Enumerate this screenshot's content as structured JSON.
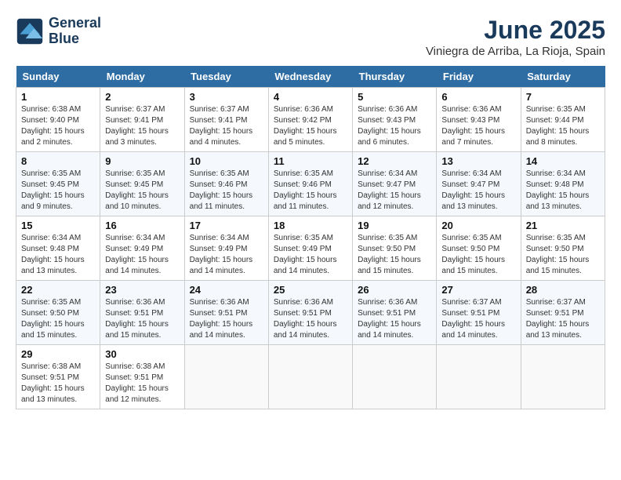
{
  "logo": {
    "line1": "General",
    "line2": "Blue"
  },
  "title": "June 2025",
  "subtitle": "Viniegra de Arriba, La Rioja, Spain",
  "weekdays": [
    "Sunday",
    "Monday",
    "Tuesday",
    "Wednesday",
    "Thursday",
    "Friday",
    "Saturday"
  ],
  "weeks": [
    [
      {
        "day": "1",
        "sunrise": "Sunrise: 6:38 AM",
        "sunset": "Sunset: 9:40 PM",
        "daylight": "Daylight: 15 hours and 2 minutes."
      },
      {
        "day": "2",
        "sunrise": "Sunrise: 6:37 AM",
        "sunset": "Sunset: 9:41 PM",
        "daylight": "Daylight: 15 hours and 3 minutes."
      },
      {
        "day": "3",
        "sunrise": "Sunrise: 6:37 AM",
        "sunset": "Sunset: 9:41 PM",
        "daylight": "Daylight: 15 hours and 4 minutes."
      },
      {
        "day": "4",
        "sunrise": "Sunrise: 6:36 AM",
        "sunset": "Sunset: 9:42 PM",
        "daylight": "Daylight: 15 hours and 5 minutes."
      },
      {
        "day": "5",
        "sunrise": "Sunrise: 6:36 AM",
        "sunset": "Sunset: 9:43 PM",
        "daylight": "Daylight: 15 hours and 6 minutes."
      },
      {
        "day": "6",
        "sunrise": "Sunrise: 6:36 AM",
        "sunset": "Sunset: 9:43 PM",
        "daylight": "Daylight: 15 hours and 7 minutes."
      },
      {
        "day": "7",
        "sunrise": "Sunrise: 6:35 AM",
        "sunset": "Sunset: 9:44 PM",
        "daylight": "Daylight: 15 hours and 8 minutes."
      }
    ],
    [
      {
        "day": "8",
        "sunrise": "Sunrise: 6:35 AM",
        "sunset": "Sunset: 9:45 PM",
        "daylight": "Daylight: 15 hours and 9 minutes."
      },
      {
        "day": "9",
        "sunrise": "Sunrise: 6:35 AM",
        "sunset": "Sunset: 9:45 PM",
        "daylight": "Daylight: 15 hours and 10 minutes."
      },
      {
        "day": "10",
        "sunrise": "Sunrise: 6:35 AM",
        "sunset": "Sunset: 9:46 PM",
        "daylight": "Daylight: 15 hours and 11 minutes."
      },
      {
        "day": "11",
        "sunrise": "Sunrise: 6:35 AM",
        "sunset": "Sunset: 9:46 PM",
        "daylight": "Daylight: 15 hours and 11 minutes."
      },
      {
        "day": "12",
        "sunrise": "Sunrise: 6:34 AM",
        "sunset": "Sunset: 9:47 PM",
        "daylight": "Daylight: 15 hours and 12 minutes."
      },
      {
        "day": "13",
        "sunrise": "Sunrise: 6:34 AM",
        "sunset": "Sunset: 9:47 PM",
        "daylight": "Daylight: 15 hours and 13 minutes."
      },
      {
        "day": "14",
        "sunrise": "Sunrise: 6:34 AM",
        "sunset": "Sunset: 9:48 PM",
        "daylight": "Daylight: 15 hours and 13 minutes."
      }
    ],
    [
      {
        "day": "15",
        "sunrise": "Sunrise: 6:34 AM",
        "sunset": "Sunset: 9:48 PM",
        "daylight": "Daylight: 15 hours and 13 minutes."
      },
      {
        "day": "16",
        "sunrise": "Sunrise: 6:34 AM",
        "sunset": "Sunset: 9:49 PM",
        "daylight": "Daylight: 15 hours and 14 minutes."
      },
      {
        "day": "17",
        "sunrise": "Sunrise: 6:34 AM",
        "sunset": "Sunset: 9:49 PM",
        "daylight": "Daylight: 15 hours and 14 minutes."
      },
      {
        "day": "18",
        "sunrise": "Sunrise: 6:35 AM",
        "sunset": "Sunset: 9:49 PM",
        "daylight": "Daylight: 15 hours and 14 minutes."
      },
      {
        "day": "19",
        "sunrise": "Sunrise: 6:35 AM",
        "sunset": "Sunset: 9:50 PM",
        "daylight": "Daylight: 15 hours and 15 minutes."
      },
      {
        "day": "20",
        "sunrise": "Sunrise: 6:35 AM",
        "sunset": "Sunset: 9:50 PM",
        "daylight": "Daylight: 15 hours and 15 minutes."
      },
      {
        "day": "21",
        "sunrise": "Sunrise: 6:35 AM",
        "sunset": "Sunset: 9:50 PM",
        "daylight": "Daylight: 15 hours and 15 minutes."
      }
    ],
    [
      {
        "day": "22",
        "sunrise": "Sunrise: 6:35 AM",
        "sunset": "Sunset: 9:50 PM",
        "daylight": "Daylight: 15 hours and 15 minutes."
      },
      {
        "day": "23",
        "sunrise": "Sunrise: 6:36 AM",
        "sunset": "Sunset: 9:51 PM",
        "daylight": "Daylight: 15 hours and 15 minutes."
      },
      {
        "day": "24",
        "sunrise": "Sunrise: 6:36 AM",
        "sunset": "Sunset: 9:51 PM",
        "daylight": "Daylight: 15 hours and 14 minutes."
      },
      {
        "day": "25",
        "sunrise": "Sunrise: 6:36 AM",
        "sunset": "Sunset: 9:51 PM",
        "daylight": "Daylight: 15 hours and 14 minutes."
      },
      {
        "day": "26",
        "sunrise": "Sunrise: 6:36 AM",
        "sunset": "Sunset: 9:51 PM",
        "daylight": "Daylight: 15 hours and 14 minutes."
      },
      {
        "day": "27",
        "sunrise": "Sunrise: 6:37 AM",
        "sunset": "Sunset: 9:51 PM",
        "daylight": "Daylight: 15 hours and 14 minutes."
      },
      {
        "day": "28",
        "sunrise": "Sunrise: 6:37 AM",
        "sunset": "Sunset: 9:51 PM",
        "daylight": "Daylight: 15 hours and 13 minutes."
      }
    ],
    [
      {
        "day": "29",
        "sunrise": "Sunrise: 6:38 AM",
        "sunset": "Sunset: 9:51 PM",
        "daylight": "Daylight: 15 hours and 13 minutes."
      },
      {
        "day": "30",
        "sunrise": "Sunrise: 6:38 AM",
        "sunset": "Sunset: 9:51 PM",
        "daylight": "Daylight: 15 hours and 12 minutes."
      },
      null,
      null,
      null,
      null,
      null
    ]
  ]
}
